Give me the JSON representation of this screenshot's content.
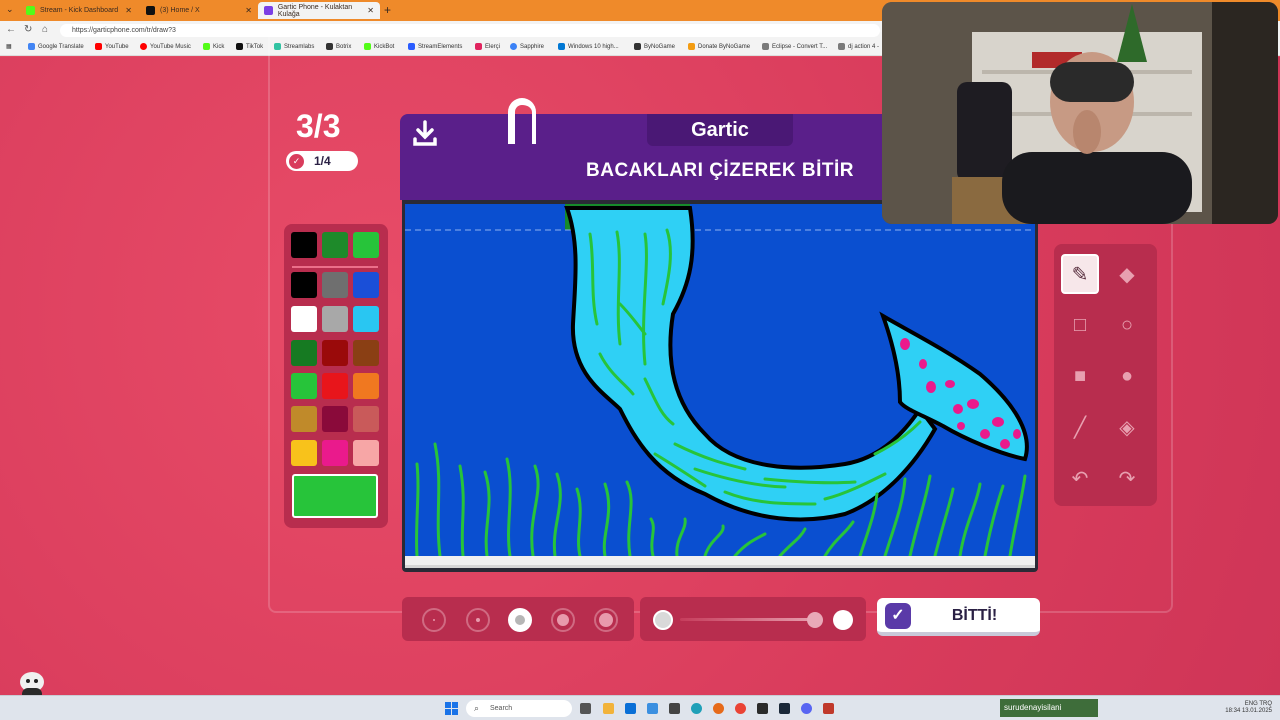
{
  "browser": {
    "tabs": [
      {
        "label": "Stream - Kick Dashboard",
        "color": "#53fc18"
      },
      {
        "label": "(3) Home / X",
        "color": "#111111"
      },
      {
        "label": "Gartic Phone - Kulaktan Kulağa",
        "color": "#7b3fe4"
      }
    ],
    "url": "https://garticphone.com/tr/draw?3",
    "bookmarks": [
      {
        "label": "Google Translate",
        "color": "#4285f4"
      },
      {
        "label": "YouTube",
        "color": "#ff0000"
      },
      {
        "label": "YouTube Music",
        "color": "#ff0000"
      },
      {
        "label": "Kick",
        "color": "#53fc18"
      },
      {
        "label": "TikTok",
        "color": "#111111"
      },
      {
        "label": "Streamlabs",
        "color": "#31c3a2"
      },
      {
        "label": "Botrix",
        "color": "#333333"
      },
      {
        "label": "KickBot",
        "color": "#53fc18"
      },
      {
        "label": "StreamElements",
        "color": "#2a5cff"
      },
      {
        "label": "Elerçi",
        "color": "#e0245e"
      },
      {
        "label": "Sapphire",
        "color": "#3b82f6"
      },
      {
        "label": "Windows 10 high...",
        "color": "#0078d4"
      },
      {
        "label": "ByNoGame",
        "color": "#333333"
      },
      {
        "label": "Donate ByNoGame",
        "color": "#f39c12"
      },
      {
        "label": "Eclipse - Convert T...",
        "color": "#7a7a7a"
      },
      {
        "label": "dj action 4 -",
        "color": "#7a7a7a"
      }
    ]
  },
  "game": {
    "round": "3/3",
    "done_count": "1/4",
    "logo": "Gartic",
    "task": "BACAKLARI ÇİZEREK BİTİR",
    "done_button": "BİTTİ!",
    "palette": [
      "#000000",
      "#1e8a2a",
      "#27c43a",
      "#000000",
      "#6f6f6f",
      "#1a4fd8",
      "#ffffff",
      "#a8a8a8",
      "#29c6f2",
      "#167a22",
      "#9a0a0a",
      "#8a3f14",
      "#27c43a",
      "#e8151b",
      "#f07820",
      "#c08a2a",
      "#8a0a3a",
      "#c95a5a",
      "#f8c21b",
      "#ea1a8c",
      "#f7a6a6"
    ],
    "selected_color": "#27c43a",
    "tools": [
      "pencil-icon",
      "eraser-icon",
      "rectangle-outline-icon",
      "circle-outline-icon",
      "rectangle-filled-icon",
      "circle-filled-icon",
      "line-icon",
      "fill-bucket-icon",
      "undo-icon",
      "redo-icon"
    ],
    "brush_sizes": 5,
    "selected_brush": 3
  },
  "taskbar": {
    "search": "Search",
    "banner": "surudenayisilani",
    "time": "18:34",
    "date": "13.01.2025",
    "lang": "ENG TRQ"
  }
}
